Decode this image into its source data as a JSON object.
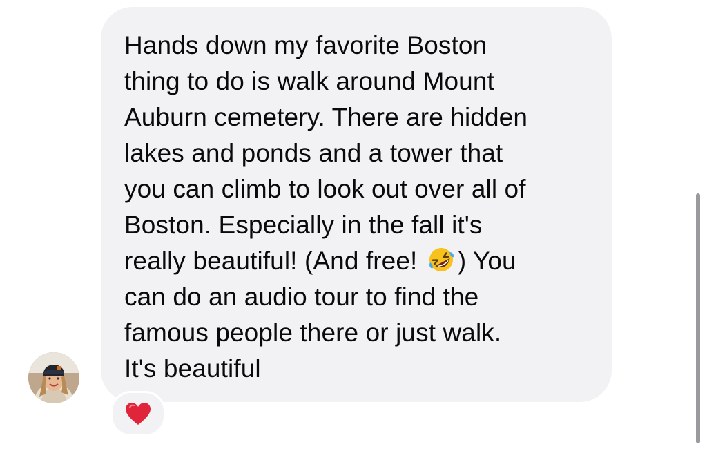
{
  "message": {
    "lines": [
      "Hands down my favorite Boston",
      "thing to do is walk around Mount",
      "Auburn cemetery. There are hidden",
      "lakes and ponds and a tower that",
      "you can climb to look out over all of",
      "Boston. Especially in the fall it's",
      "really beautiful! (And free!",
      ") You",
      "can do an audio tour to find the",
      "famous people there or just walk.",
      "It's beautiful"
    ],
    "inline_emoji": "rolling-on-floor-laughing-emoji"
  },
  "reaction": {
    "emoji": "red-heart-emoji"
  },
  "avatar": {
    "description_icon": "user-avatar"
  },
  "colors": {
    "bubble": "#f2f2f5",
    "text": "#0a0a0a",
    "heart": "#e0243a",
    "emoji_face": "#f7c21b",
    "scrollbar": "#9a9a9e"
  }
}
